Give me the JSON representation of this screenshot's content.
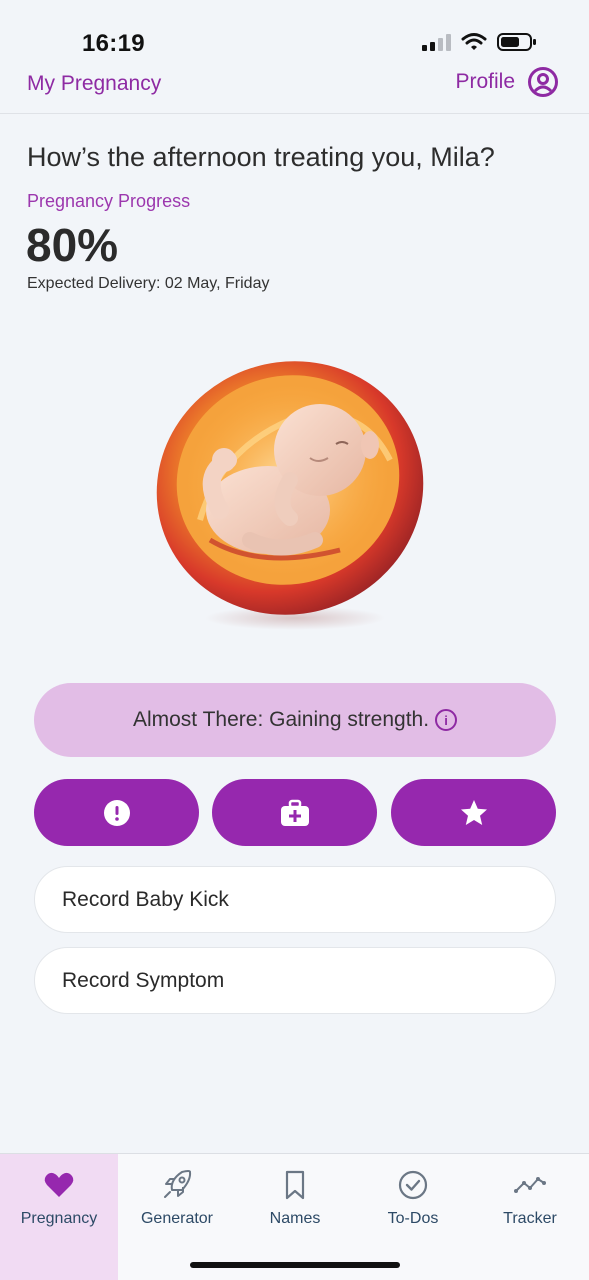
{
  "status_bar": {
    "time": "16:19"
  },
  "header": {
    "title": "My Pregnancy",
    "profile_label": "Profile"
  },
  "main": {
    "greeting": "How’s the afternoon treating you, Mila?",
    "progress_label": "Pregnancy Progress",
    "progress_value": "80%",
    "progress_fraction": 0.8,
    "delivery_text": "Expected Delivery: 02 May, Friday",
    "illustration": "fetus-in-womb-illustration",
    "stage_text": "Almost There: Gaining strength.",
    "action_buttons": [
      {
        "icon": "alert-icon"
      },
      {
        "icon": "medical-kit-icon"
      },
      {
        "icon": "star-icon"
      }
    ],
    "record_items": [
      {
        "label": "Record Baby Kick"
      },
      {
        "label": "Record Symptom"
      }
    ]
  },
  "bottom_nav": {
    "items": [
      {
        "label": "Pregnancy",
        "icon": "heart-icon",
        "active": true
      },
      {
        "label": "Generator",
        "icon": "rocket-icon",
        "active": false
      },
      {
        "label": "Names",
        "icon": "bookmark-icon",
        "active": false
      },
      {
        "label": "To-Dos",
        "icon": "check-circle-icon",
        "active": false
      },
      {
        "label": "Tracker",
        "icon": "trend-line-icon",
        "active": false
      }
    ]
  },
  "colors": {
    "accent": "#9628ae",
    "accent_text": "#8e2aa3",
    "banner_bg": "#e2bde6",
    "nav_active_bg": "#f1dbf3",
    "background": "#f2f5f9"
  }
}
